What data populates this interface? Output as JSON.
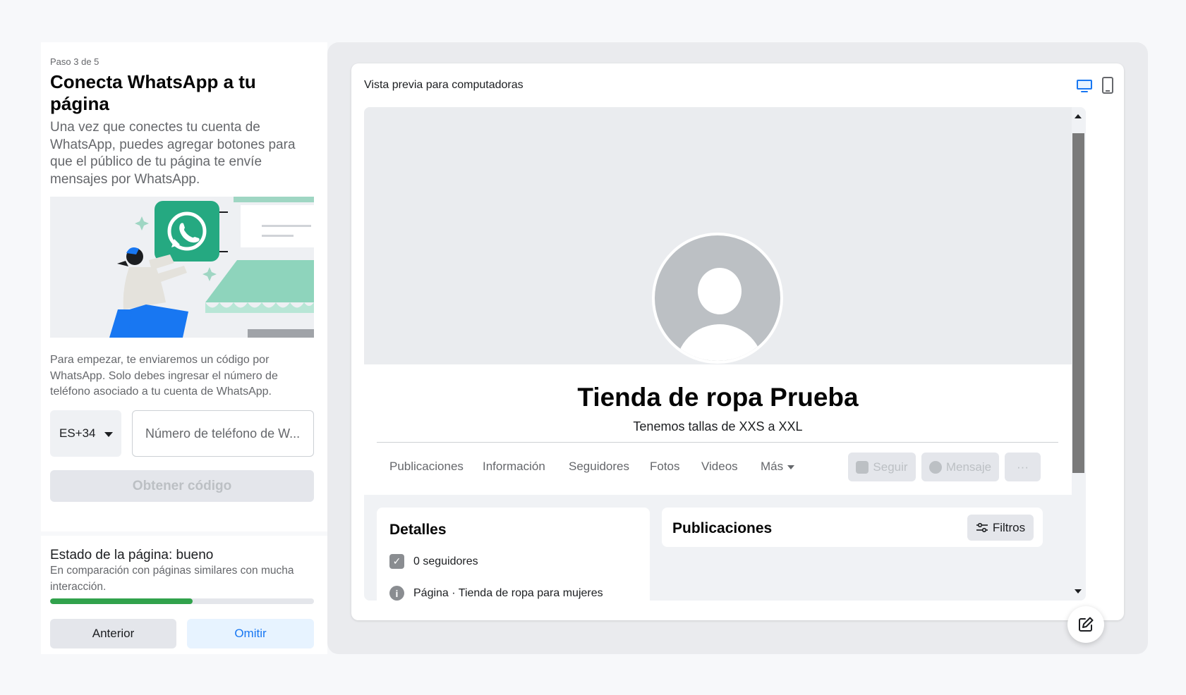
{
  "left": {
    "step": "Paso 3 de 5",
    "title": "Conecta WhatsApp a tu página",
    "description": "Una vez que conectes tu cuenta de WhatsApp, puedes agregar botones para que el público de tu página te envíe mensajes por WhatsApp.",
    "intro": "Para empezar, te enviaremos un código por WhatsApp. Solo debes ingresar el número de teléfono asociado a tu cuenta de WhatsApp.",
    "country_code": "ES+34",
    "phone_placeholder": "Número de teléfono de W...",
    "get_code_label": "Obtener código",
    "status_title": "Estado de la página: bueno",
    "status_desc": "En comparación con páginas similares con mucha interacción.",
    "status_progress": 0.54,
    "prev_label": "Anterior",
    "skip_label": "Omitir"
  },
  "preview": {
    "title": "Vista previa para computadoras",
    "devices": [
      "desktop-icon",
      "mobile-icon"
    ],
    "page_name": "Tienda de ropa Prueba",
    "tagline": "Tenemos tallas de XXS a XXL",
    "tabs": [
      "Publicaciones",
      "Información",
      "Seguidores",
      "Fotos",
      "Videos",
      "Más"
    ],
    "actions": {
      "follow": "Seguir",
      "message": "Mensaje",
      "more": "···"
    },
    "details": {
      "title": "Detalles",
      "followers": "0 seguidores",
      "category_prefix": "Página",
      "category": " · Tienda de ropa para mujeres"
    },
    "posts": {
      "title": "Publicaciones",
      "filters": "Filtros"
    }
  },
  "colors": {
    "accent": "#1877f2",
    "progress": "#31a24c",
    "whatsapp": "#25a981"
  }
}
